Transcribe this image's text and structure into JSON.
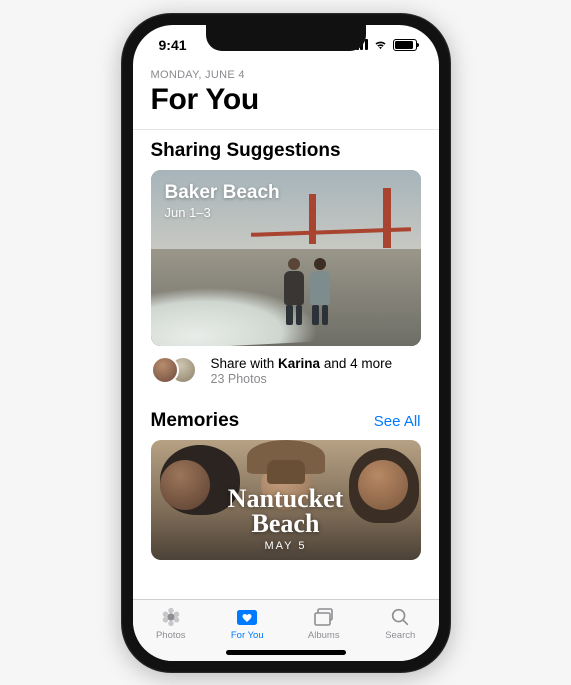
{
  "status": {
    "time": "9:41"
  },
  "header": {
    "date": "MONDAY, JUNE 4",
    "title": "For You"
  },
  "sharing": {
    "section_title": "Sharing Suggestions",
    "card": {
      "title": "Baker Beach",
      "subtitle": "Jun 1–3"
    },
    "share_prefix": "Share with ",
    "share_name": "Karina",
    "share_suffix": " and 4 more",
    "share_count": "23 Photos"
  },
  "memories": {
    "section_title": "Memories",
    "see_all": "See All",
    "card": {
      "title_line1": "Nantucket",
      "title_line2": "Beach",
      "subtitle": "MAY 5"
    }
  },
  "tabs": {
    "photos": "Photos",
    "for_you": "For You",
    "albums": "Albums",
    "search": "Search"
  }
}
